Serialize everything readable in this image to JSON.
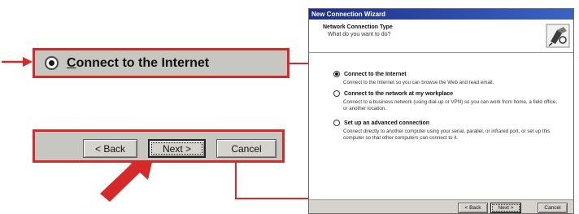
{
  "callouts": {
    "option_label": "Connect to the Internet",
    "back_label": "< Back",
    "next_label": "Next >",
    "cancel_label": "Cancel"
  },
  "wizard": {
    "window_title": "New Connection Wizard",
    "header_title": "Network Connection Type",
    "header_subtitle": "What do you want to do?",
    "options": [
      {
        "label": "Connect to the Internet",
        "description": "Connect to the Internet so you can browse the Web and read email.",
        "selected": true
      },
      {
        "label": "Connect to the network at my workplace",
        "description": "Connect to a business network (using dial-up or VPN) so you can work from home, a field office, or another location.",
        "selected": false
      },
      {
        "label": "Set up an advanced connection",
        "description": "Connect directly to another computer using your serial, parallel, or infrared port, or set up this computer so that other computers can connect to it.",
        "selected": false
      }
    ],
    "buttons": {
      "back": "< Back",
      "next": "Next >",
      "cancel": "Cancel"
    }
  },
  "colors": {
    "callout_border": "#d62a2a",
    "arrow": "#d62a2a",
    "titlebar": "#1d2f8a",
    "dialog_face": "#d6d3cc"
  },
  "icons": {
    "wizard_icon": "network-connection-icon",
    "pointer_arrow": "red-arrow-icon"
  }
}
